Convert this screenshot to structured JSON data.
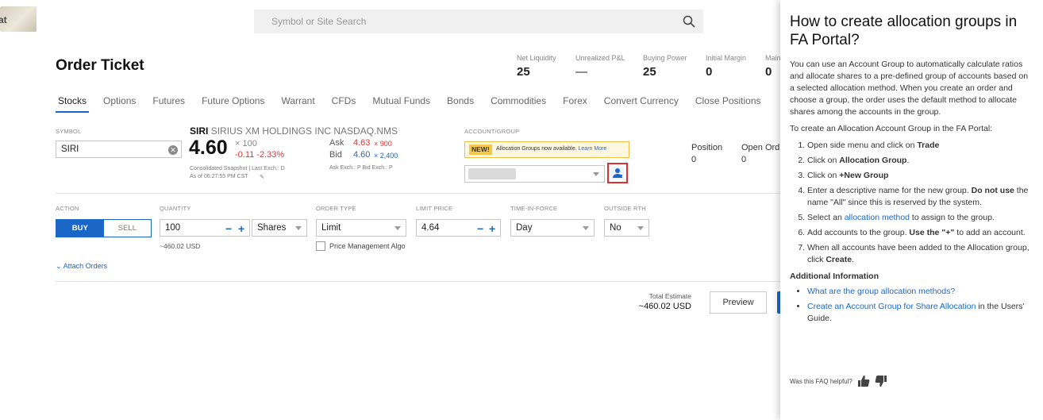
{
  "logo_text": "at",
  "search": {
    "placeholder": "Symbol or Site Search"
  },
  "page_title": "Order Ticket",
  "metrics": [
    {
      "label": "Net Liquidity",
      "value": "25"
    },
    {
      "label": "Unrealized P&L",
      "value": "—"
    },
    {
      "label": "Buying Power",
      "value": "25"
    },
    {
      "label": "Initial Margin",
      "value": "0"
    },
    {
      "label": "Main",
      "value": "0"
    }
  ],
  "tabs": [
    "Stocks",
    "Options",
    "Futures",
    "Future Options",
    "Warrant",
    "CFDs",
    "Mutual Funds",
    "Bonds",
    "Commodities",
    "Forex",
    "Convert Currency",
    "Close Positions"
  ],
  "symbol": {
    "caption": "SYMBOL",
    "value": "SIRI"
  },
  "quote": {
    "ticker": "SIRI",
    "name": "SIRIUS XM HOLDINGS INC NASDAQ.NMS",
    "price": "4.60",
    "multiplier": "× 100",
    "change": "-0.11 -2.33%",
    "snapshot": "Consolidated Snapshot | Last Exch.: D",
    "as_of": "As of 06:27:55 PM CST",
    "ask_label": "Ask",
    "ask_price": "4.63",
    "ask_size": "× 900",
    "bid_label": "Bid",
    "bid_price": "4.60",
    "bid_size": "× 2,400",
    "exch_line": "Ask Exch.: P  Bid Exch.: P"
  },
  "account": {
    "caption": "ACCOUNT/GROUP",
    "new_badge": "NEW!",
    "new_msg": "Allocation Groups now available.",
    "learn_more": "Learn More"
  },
  "position": {
    "label": "Position",
    "value": "0"
  },
  "open_orders": {
    "label": "Open Ord",
    "value": "0"
  },
  "action": {
    "caption": "ACTION",
    "buy": "BUY",
    "sell": "SELL"
  },
  "quantity": {
    "caption": "QUANTITY",
    "value": "100",
    "unit": "Shares",
    "estimate": "~460.02 USD"
  },
  "order_type": {
    "caption": "ORDER TYPE",
    "value": "Limit",
    "algo": "Price Management Algo"
  },
  "limit_price": {
    "caption": "LIMIT PRICE",
    "value": "4.64"
  },
  "tif": {
    "caption": "TIME-IN-FORCE",
    "value": "Day"
  },
  "rth": {
    "caption": "OUTSIDE RTH",
    "value": "No"
  },
  "attach_orders": "Attach Orders",
  "total": {
    "label": "Total Estimate",
    "value": "~460.02 USD"
  },
  "preview_label": "Preview",
  "faq": {
    "title": "How to create allocation groups in FA Portal?",
    "intro": "You can use an Account Group to automatically calculate ratios and allocate shares to a pre-defined group of accounts based on a selected allocation method. When you create an order and choose a group, the order uses the default method to allocate shares among the accounts in the group.",
    "steps_intro": "To create an Allocation Account Group in the FA Portal:",
    "steps": {
      "s1a": "Open side menu and click on ",
      "s1b": "Trade",
      "s2a": "Click on ",
      "s2b": "Allocation Group",
      "s3a": "Click on ",
      "s3b": "+New Group",
      "s4a": "Enter a descriptive name for the new group. ",
      "s4b": "Do not use",
      "s4c": " the name \"All\" since this is reserved by the system.",
      "s5a": "Select an ",
      "s5b": "allocation method",
      "s5c": " to assign to the group.",
      "s6a": "Add accounts to the group. ",
      "s6b": "Use the \"+\"",
      "s6c": " to add an account.",
      "s7a": "When all accounts have been added to the Allocation group, click ",
      "s7b": "Create"
    },
    "additional": "Additional Information",
    "link1": "What are the group allocation methods?",
    "link2": "Create an Account Group for Share Allocation",
    "link2_suffix": " in the Users' Guide.",
    "helpful": "Was this FAQ helpful?"
  },
  "colors": {
    "accent": "#1a67c7",
    "negative": "#dd3333",
    "highlight": "#d93030"
  }
}
